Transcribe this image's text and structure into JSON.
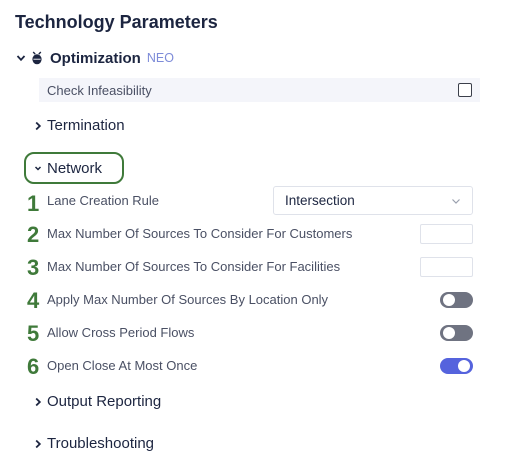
{
  "page": {
    "title": "Technology Parameters"
  },
  "optimization": {
    "title": "Optimization",
    "badge": "NEO",
    "check_infeasibility": {
      "label": "Check Infeasibility",
      "checked": false
    }
  },
  "sections": {
    "termination": "Termination",
    "network": "Network",
    "output_reporting": "Output Reporting",
    "troubleshooting": "Troubleshooting"
  },
  "network": {
    "params": [
      {
        "number": "1",
        "label": "Lane Creation Rule",
        "control": "select",
        "value": "Intersection"
      },
      {
        "number": "2",
        "label": "Max Number Of Sources To Consider For Customers",
        "control": "input",
        "value": ""
      },
      {
        "number": "3",
        "label": "Max Number Of Sources To Consider For Facilities",
        "control": "input",
        "value": ""
      },
      {
        "number": "4",
        "label": "Apply Max Number Of Sources By Location Only",
        "control": "toggle",
        "on": false
      },
      {
        "number": "5",
        "label": "Allow Cross Period Flows",
        "control": "toggle",
        "on": false
      },
      {
        "number": "6",
        "label": "Open Close At Most Once",
        "control": "toggle",
        "on": true
      }
    ]
  },
  "colors": {
    "accent": "#5563dd",
    "annotation": "#3f7a3a",
    "toggle_off": "#6f7381"
  }
}
